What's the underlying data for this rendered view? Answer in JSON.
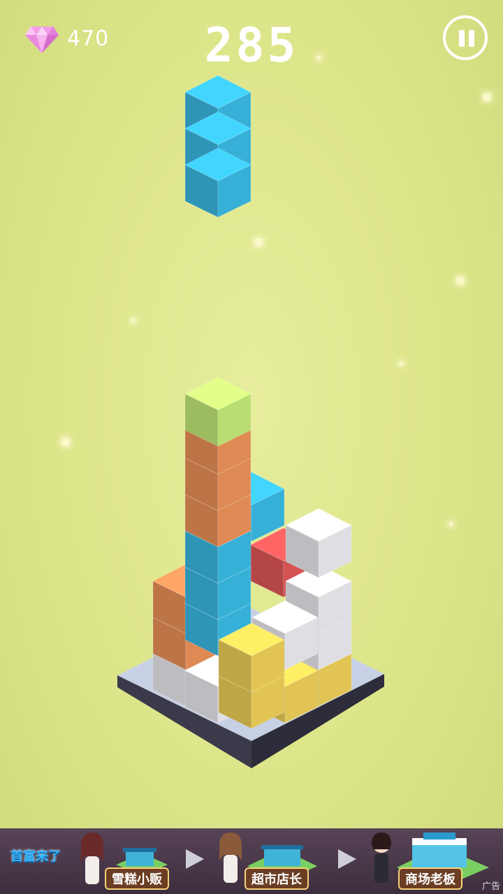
{
  "hud": {
    "gem_count": "470",
    "score": "285",
    "gem_icon": "diamond-icon",
    "pause_icon": "pause-icon"
  },
  "colors": {
    "background": "#dde58a",
    "blue": "#3bbfea",
    "orange": "#f2955b",
    "green": "#c9f07a",
    "yellow": "#f5d55a",
    "white": "#f2f2f7",
    "red": "#e85a5a",
    "platform": "#c8d0e6"
  },
  "ad": {
    "logo": "首富来了",
    "stage1": "雪糕小贩",
    "stage2": "超市店长",
    "stage3": "商场老板",
    "tag": "广告"
  }
}
